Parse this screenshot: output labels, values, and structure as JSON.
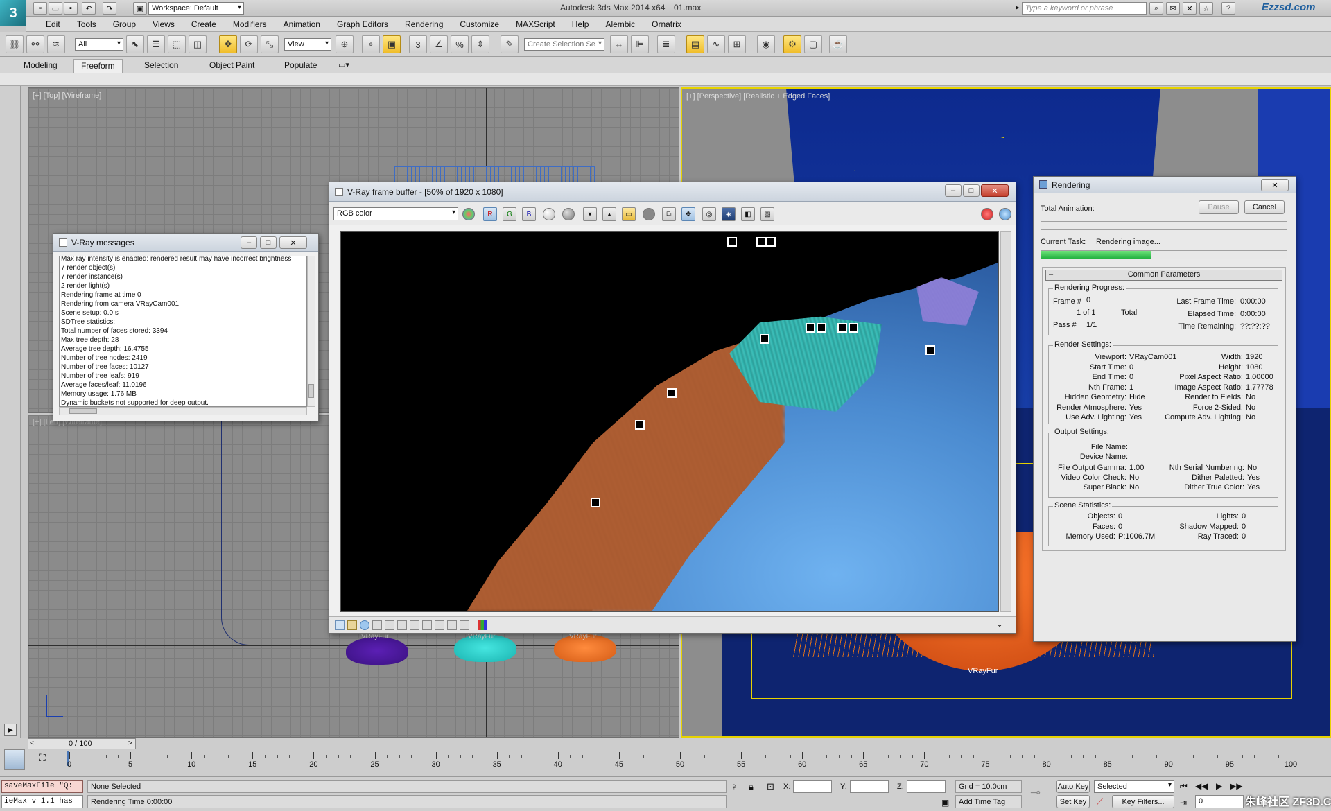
{
  "app": {
    "title": "Autodesk 3ds Max  2014 x64",
    "file": "01.max",
    "workspace": "Workspace: Default",
    "search_placeholder": "Type a keyword or phrase",
    "watermark": "Ezzsd.com",
    "watermark_bottom": "朱峰社区 ZF3D.COM"
  },
  "menu": [
    "Edit",
    "Tools",
    "Group",
    "Views",
    "Create",
    "Modifiers",
    "Animation",
    "Graph Editors",
    "Rendering",
    "Customize",
    "MAXScript",
    "Help",
    "Alembic",
    "Ornatrix"
  ],
  "toolbar": {
    "selection_filter": "All",
    "ref_coord": "View",
    "named_selection_placeholder": "Create Selection Se"
  },
  "ribbon": {
    "tabs": [
      "Modeling",
      "Freeform",
      "Selection",
      "Object Paint",
      "Populate"
    ],
    "selected": "Freeform"
  },
  "viewports": {
    "top": "[+] [Top] [Wireframe]",
    "perspective": "[+] [Perspective] [Realistic + Edged Faces]",
    "left": "[+] [Left] [Wireframe]",
    "fur_labels": [
      "VRayFur",
      "VRayFur",
      "VRayFur"
    ],
    "persp_fur_label": "VRayFur"
  },
  "vray_messages": {
    "title": "V-Ray messages",
    "lines": [
      "Max ray intensity is enabled: rendered result may have incorrect brightness",
      "7 render object(s)",
      "7 render instance(s)",
      "2 render light(s)",
      "Rendering frame at time 0",
      "Rendering from camera VRayCam001",
      "Scene setup: 0.0 s",
      "SDTree statistics:",
      "Total number of faces stored: 3394",
      "Max tree depth: 28",
      "Average tree depth: 16.4755",
      "Number of tree nodes: 2419",
      "Number of tree faces: 10127",
      "Number of tree leafs: 919",
      "Average faces/leaf: 11.0196",
      "Memory usage: 1.76 MB",
      "Dynamic buckets not supported for deep output."
    ]
  },
  "frame_buffer": {
    "title": "V-Ray frame buffer - [50% of 1920 x 1080]",
    "channel": "RGB color",
    "channel_buttons": [
      "R",
      "G",
      "B"
    ]
  },
  "rendering": {
    "title": "Rendering",
    "total_animation_label": "Total Animation:",
    "total_animation_progress": 0.0,
    "current_task_label": "Current Task:",
    "current_task": "Rendering image...",
    "current_task_progress": 0.45,
    "pause": "Pause",
    "cancel": "Cancel",
    "section": "Common Parameters",
    "progress": {
      "title": "Rendering Progress:",
      "frame_label": "Frame #",
      "frame": "0",
      "of": "1 of 1",
      "total": "Total",
      "pass_label": "Pass #",
      "pass": "1/1",
      "last_frame_time_label": "Last Frame Time:",
      "last_frame_time": "0:00:00",
      "elapsed_label": "Elapsed Time:",
      "elapsed": "0:00:00",
      "remaining_label": "Time Remaining:",
      "remaining": "??:??:??"
    },
    "render_settings": {
      "title": "Render Settings:",
      "left": [
        {
          "label": "Viewport:",
          "value": "VRayCam001"
        },
        {
          "label": "Start Time:",
          "value": "0"
        },
        {
          "label": "End Time:",
          "value": "0"
        },
        {
          "label": "Nth Frame:",
          "value": "1"
        },
        {
          "label": "Hidden Geometry:",
          "value": "Hide"
        },
        {
          "label": "Render Atmosphere:",
          "value": "Yes"
        },
        {
          "label": "Use Adv. Lighting:",
          "value": "Yes"
        }
      ],
      "right": [
        {
          "label": "Width:",
          "value": "1920"
        },
        {
          "label": "Height:",
          "value": "1080"
        },
        {
          "label": "Pixel Aspect Ratio:",
          "value": "1.00000"
        },
        {
          "label": "Image Aspect Ratio:",
          "value": "1.77778"
        },
        {
          "label": "Render to Fields:",
          "value": "No"
        },
        {
          "label": "Force 2-Sided:",
          "value": "No"
        },
        {
          "label": "Compute Adv. Lighting:",
          "value": "No"
        }
      ]
    },
    "output_settings": {
      "title": "Output Settings:",
      "file_name_label": "File Name:",
      "device_name_label": "Device Name:",
      "left": [
        {
          "label": "File Output Gamma:",
          "value": "1.00"
        },
        {
          "label": "Video Color Check:",
          "value": "No"
        },
        {
          "label": "Super Black:",
          "value": "No"
        }
      ],
      "right": [
        {
          "label": "Nth Serial Numbering:",
          "value": "No"
        },
        {
          "label": "Dither Paletted:",
          "value": "Yes"
        },
        {
          "label": "Dither True Color:",
          "value": "Yes"
        }
      ]
    },
    "scene_statistics": {
      "title": "Scene Statistics:",
      "left": [
        {
          "label": "Objects:",
          "value": "0"
        },
        {
          "label": "Faces:",
          "value": "0"
        },
        {
          "label": "Memory Used:",
          "value": "P:1006.7M"
        }
      ],
      "right": [
        {
          "label": "Lights:",
          "value": "0"
        },
        {
          "label": "Shadow Mapped:",
          "value": "0"
        },
        {
          "label": "Ray Traced:",
          "value": "0"
        }
      ]
    }
  },
  "timeline": {
    "slider": "0 / 100",
    "ticks": [
      "0",
      "5",
      "10",
      "15",
      "20",
      "25",
      "30",
      "35",
      "40",
      "45",
      "50",
      "55",
      "60",
      "65",
      "70",
      "75",
      "80",
      "85",
      "90",
      "95",
      "100"
    ]
  },
  "status": {
    "script1": "saveMaxFile \"Q:",
    "script2": "ieMax v 1.1 has",
    "selection": "None Selected",
    "render_time": "Rendering Time  0:00:00",
    "x_label": "X:",
    "y_label": "Y:",
    "z_label": "Z:",
    "grid": "Grid = 10.0cm",
    "add_time_tag": "Add Time Tag",
    "auto_key": "Auto Key",
    "set_key": "Set Key",
    "key_mode": "Selected",
    "key_filters": "Key Filters...",
    "frame": "0"
  }
}
